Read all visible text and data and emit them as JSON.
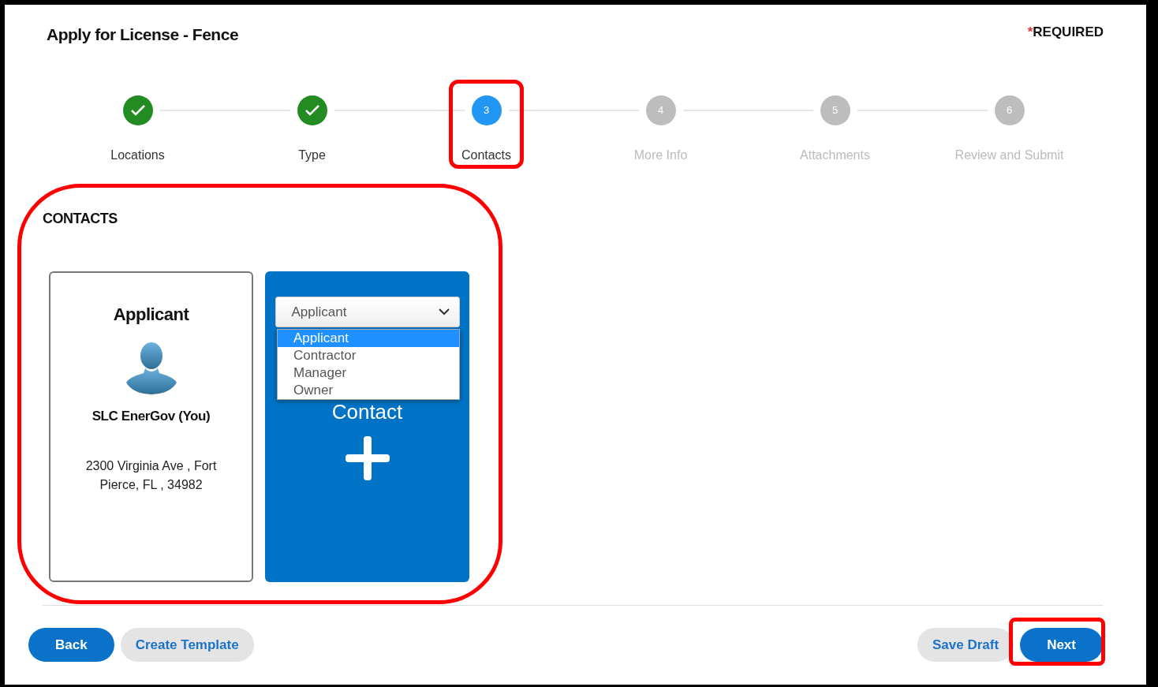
{
  "page": {
    "title": "Apply for License - Fence",
    "required_note": {
      "mark": "*",
      "label": "REQUIRED"
    }
  },
  "steps": [
    {
      "label": "Locations",
      "kind": "done"
    },
    {
      "label": "Type",
      "kind": "done"
    },
    {
      "number": "3",
      "label": "Contacts",
      "kind": "current"
    },
    {
      "number": "4",
      "label": "More Info",
      "kind": "pending"
    },
    {
      "number": "5",
      "label": "Attachments",
      "kind": "pending"
    },
    {
      "number": "6",
      "label": "Review and Submit",
      "kind": "pending"
    }
  ],
  "contacts": {
    "heading": "CONTACTS",
    "card": {
      "role": "Applicant",
      "name": "SLC EnerGov (You)",
      "address": "2300 Virginia Ave , Fort Pierce, FL , 34982"
    },
    "add_card": {
      "label": "Contact",
      "select": {
        "value": "Applicant",
        "options": [
          {
            "label": "Applicant",
            "selected": true
          },
          {
            "label": "Contractor",
            "selected": false
          },
          {
            "label": "Manager",
            "selected": false
          },
          {
            "label": "Owner",
            "selected": false
          }
        ]
      }
    }
  },
  "buttons_left": [
    {
      "label": "Back",
      "kind": "primary"
    },
    {
      "label": "Create Template",
      "kind": "secondary"
    }
  ],
  "buttons_right": [
    {
      "label": "Save Draft",
      "kind": "secondary"
    },
    {
      "label": "Next",
      "kind": "primary"
    }
  ],
  "highlights": [
    {
      "kind": "step"
    },
    {
      "kind": "section"
    },
    {
      "kind": "button"
    }
  ]
}
